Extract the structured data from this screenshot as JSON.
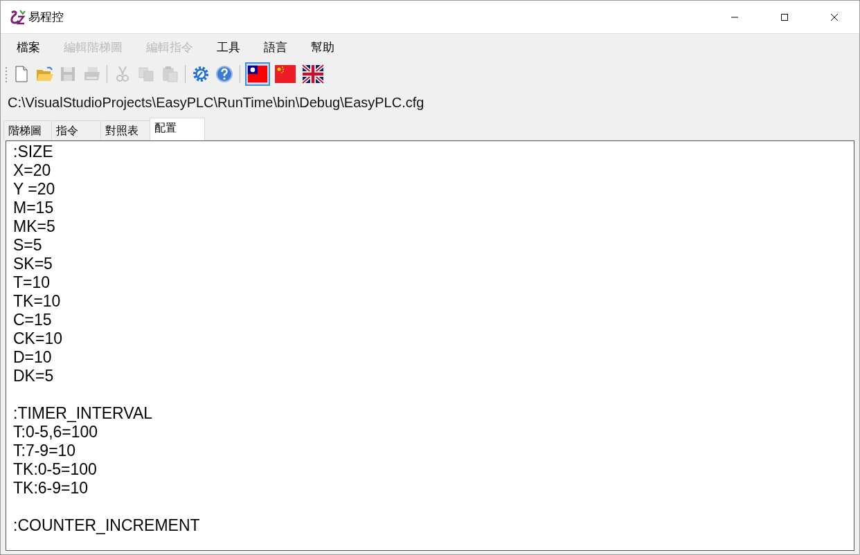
{
  "window": {
    "title": "易程控"
  },
  "menu": [
    {
      "label": "檔案",
      "disabled": false
    },
    {
      "label": "編輯階梯圖",
      "disabled": true
    },
    {
      "label": "編輯指令",
      "disabled": true
    },
    {
      "label": "工具",
      "disabled": false
    },
    {
      "label": "語言",
      "disabled": false
    },
    {
      "label": "幫助",
      "disabled": false
    }
  ],
  "toolbar": [
    {
      "kind": "new",
      "disabled": false
    },
    {
      "kind": "open",
      "disabled": false
    },
    {
      "kind": "save",
      "disabled": true
    },
    {
      "kind": "print",
      "disabled": true
    },
    {
      "kind": "sep"
    },
    {
      "kind": "cut",
      "disabled": true
    },
    {
      "kind": "copy",
      "disabled": true
    },
    {
      "kind": "paste",
      "disabled": true
    },
    {
      "kind": "sep"
    },
    {
      "kind": "settings",
      "disabled": false
    },
    {
      "kind": "help",
      "disabled": false
    },
    {
      "kind": "sep"
    },
    {
      "kind": "flag-tw",
      "selected": true
    },
    {
      "kind": "flag-cn",
      "selected": false
    },
    {
      "kind": "flag-uk",
      "selected": false
    }
  ],
  "path": "C:\\VisualStudioProjects\\EasyPLC\\RunTime\\bin\\Debug\\EasyPLC.cfg",
  "tabs": [
    {
      "label": "階梯圖",
      "selected": false
    },
    {
      "label": "指令",
      "selected": false
    },
    {
      "label": "對照表",
      "selected": false
    },
    {
      "label": "配置",
      "selected": true
    }
  ],
  "editor": {
    "sections": [
      {
        "lines": [
          ":SIZE",
          "X=20",
          "Y =20",
          "M=15",
          "MK=5",
          "S=5",
          "SK=5",
          "T=10",
          "TK=10",
          "C=15",
          "CK=10",
          "D=10",
          "DK=5"
        ]
      },
      {
        "lines": [
          ":TIMER_INTERVAL",
          "T:0-5,6=100",
          "T:7-9=10",
          "TK:0-5=100",
          "TK:6-9=10"
        ]
      },
      {
        "lines": [
          ":COUNTER_INCREMENT"
        ]
      }
    ]
  }
}
